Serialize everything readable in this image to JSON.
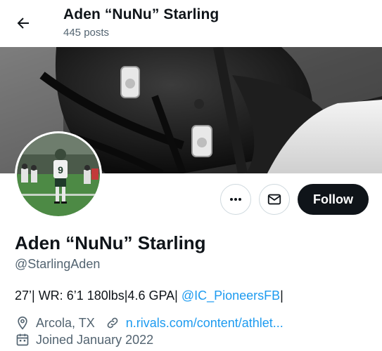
{
  "header": {
    "title": "Aden “NuNu” Starling",
    "posts_count": "445 posts"
  },
  "profile": {
    "display_name": "Aden “NuNu” Starling",
    "handle": "@StarlingAden",
    "bio_text": "27’| WR: 6’1 180lbs|4.6 GPA| ",
    "bio_mention": "@IC_PioneersFB",
    "bio_tail": "|",
    "location": "Arcola, TX",
    "website": "n.rivals.com/content/athlet...",
    "joined": "Joined January 2022"
  },
  "actions": {
    "follow_label": "Follow"
  },
  "avatar": {
    "jersey_number": "9"
  },
  "icons": {
    "back": "arrow-left-icon",
    "more": "more-dots-icon",
    "message": "envelope-icon",
    "location": "location-pin-icon",
    "link": "link-icon",
    "calendar": "calendar-icon"
  },
  "colors": {
    "accent": "#1d9bf0",
    "text_primary": "#0f1419",
    "text_secondary": "#536471",
    "follow_bg": "#0f1419",
    "border": "#cfd9de"
  }
}
